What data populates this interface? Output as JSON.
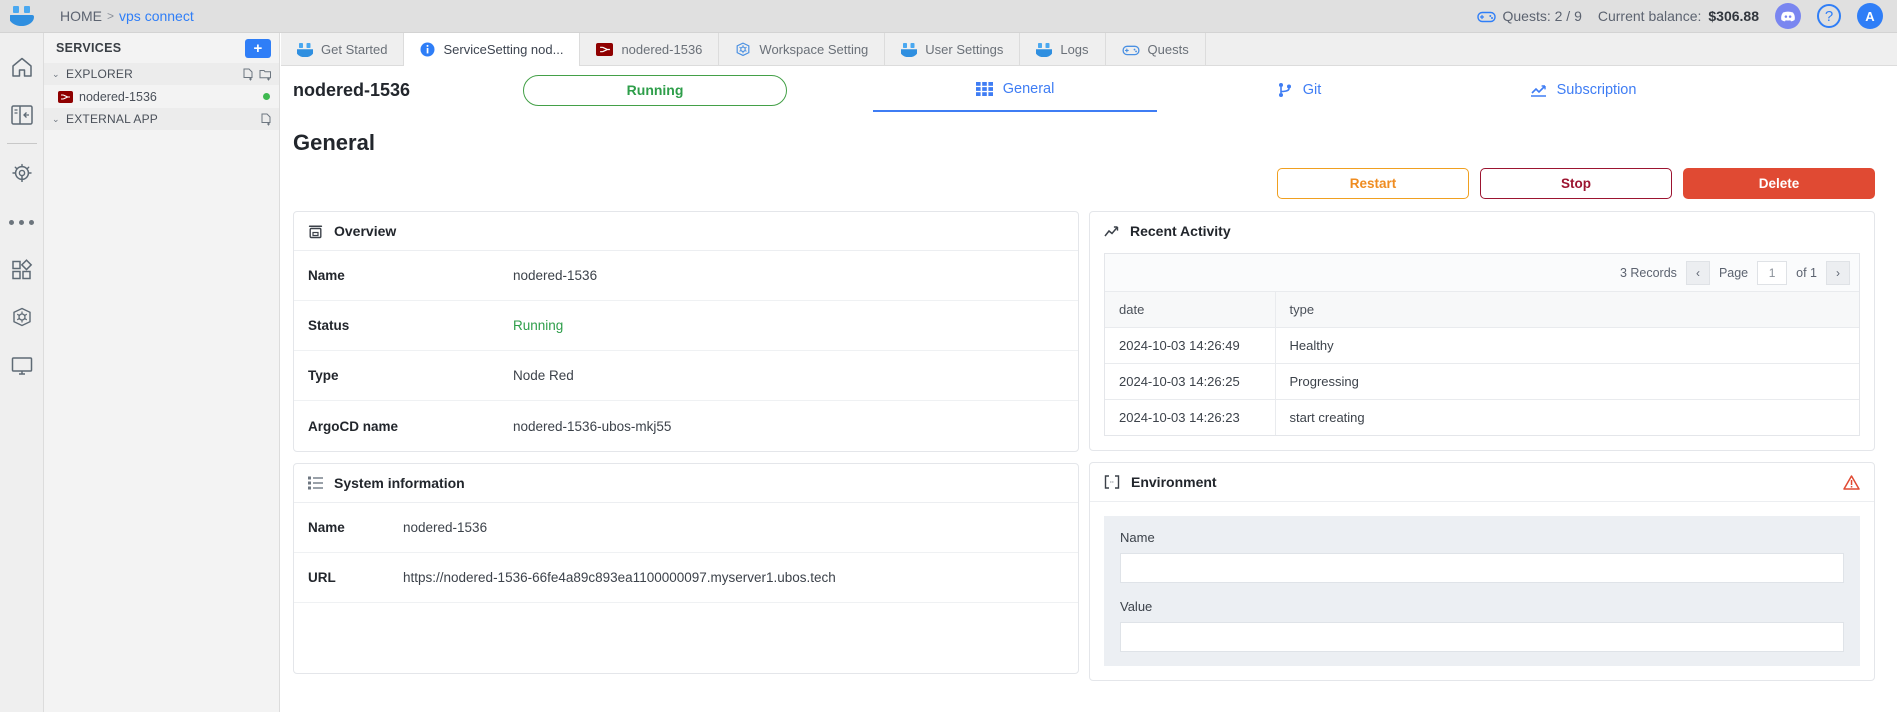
{
  "topbar": {
    "breadcrumb": {
      "home": "HOME",
      "separator": ">",
      "current": "vps connect"
    },
    "quests": "Quests: 2 / 9",
    "balance_label": "Current balance:",
    "balance_value": "$306.88",
    "avatar_initial": "A",
    "help_glyph": "?"
  },
  "rail": {
    "items": [
      {
        "name": "home-icon"
      },
      {
        "name": "panel-layout-icon"
      },
      {
        "name": "settings-gear-icon"
      },
      {
        "name": "more-dots-icon"
      },
      {
        "name": "apps-grid-icon"
      },
      {
        "name": "kubernetes-icon"
      },
      {
        "name": "monitor-icon"
      }
    ]
  },
  "services": {
    "title": "SERVICES",
    "add_label": "+",
    "sections": [
      {
        "label": "EXPLORER",
        "chevron": "⌄"
      },
      {
        "label": "EXTERNAL APP",
        "chevron": "⌄"
      }
    ],
    "service_item": {
      "label": "nodered-1536"
    }
  },
  "tabs": [
    {
      "label": "Get Started",
      "icon": "smiley-icon",
      "active": false
    },
    {
      "label": "ServiceSetting nod...",
      "icon": "info-icon",
      "active": true
    },
    {
      "label": "nodered-1536",
      "icon": "nodered-icon",
      "active": false
    },
    {
      "label": "Workspace Setting",
      "icon": "kubernetes-icon",
      "active": false
    },
    {
      "label": "User Settings",
      "icon": "smiley-icon",
      "active": false
    },
    {
      "label": "Logs",
      "icon": "smiley-icon",
      "active": false
    },
    {
      "label": "Quests",
      "icon": "gamepad-icon",
      "active": false
    }
  ],
  "service": {
    "name": "nodered-1536",
    "status_pill": "Running",
    "nav": [
      {
        "label": "General",
        "icon": "grid-icon",
        "active": true
      },
      {
        "label": "Git",
        "icon": "git-branch-icon",
        "active": false
      },
      {
        "label": "Subscription",
        "icon": "chart-icon",
        "active": false
      }
    ],
    "page_title": "General",
    "actions": {
      "restart": "Restart",
      "stop": "Stop",
      "delete": "Delete"
    }
  },
  "overview": {
    "title": "Overview",
    "rows": [
      {
        "key": "Name",
        "value": "nodered-1536"
      },
      {
        "key": "Status",
        "value": "Running"
      },
      {
        "key": "Type",
        "value": "Node Red"
      },
      {
        "key": "ArgoCD name",
        "value": "nodered-1536-ubos-mkj55"
      }
    ]
  },
  "system_information": {
    "title": "System information",
    "rows": [
      {
        "key": "Name",
        "value": "nodered-1536"
      },
      {
        "key": "URL",
        "value": "https://nodered-1536-66fe4a89c893ea1100000097.myserver1.ubos.tech"
      }
    ]
  },
  "recent_activity": {
    "title": "Recent Activity",
    "records_label": "3 Records",
    "page_label": "Page",
    "page_value": "1",
    "of_label": "of 1",
    "prev_glyph": "‹",
    "next_glyph": "›",
    "columns": [
      "date",
      "type"
    ],
    "rows": [
      {
        "date": "2024-10-03 14:26:49",
        "type": "Healthy"
      },
      {
        "date": "2024-10-03 14:26:25",
        "type": "Progressing"
      },
      {
        "date": "2024-10-03 14:26:23",
        "type": "start creating"
      }
    ]
  },
  "environment": {
    "title": "Environment",
    "name_label": "Name",
    "name_value": "",
    "value_label": "Value",
    "value_value": ""
  },
  "colors": {
    "accent_blue": "#2f7ef7",
    "running_green": "#2e9e4a",
    "danger_red": "#e04a33",
    "warn_orange": "#ef8c20",
    "stop_maroon": "#9c1430"
  }
}
